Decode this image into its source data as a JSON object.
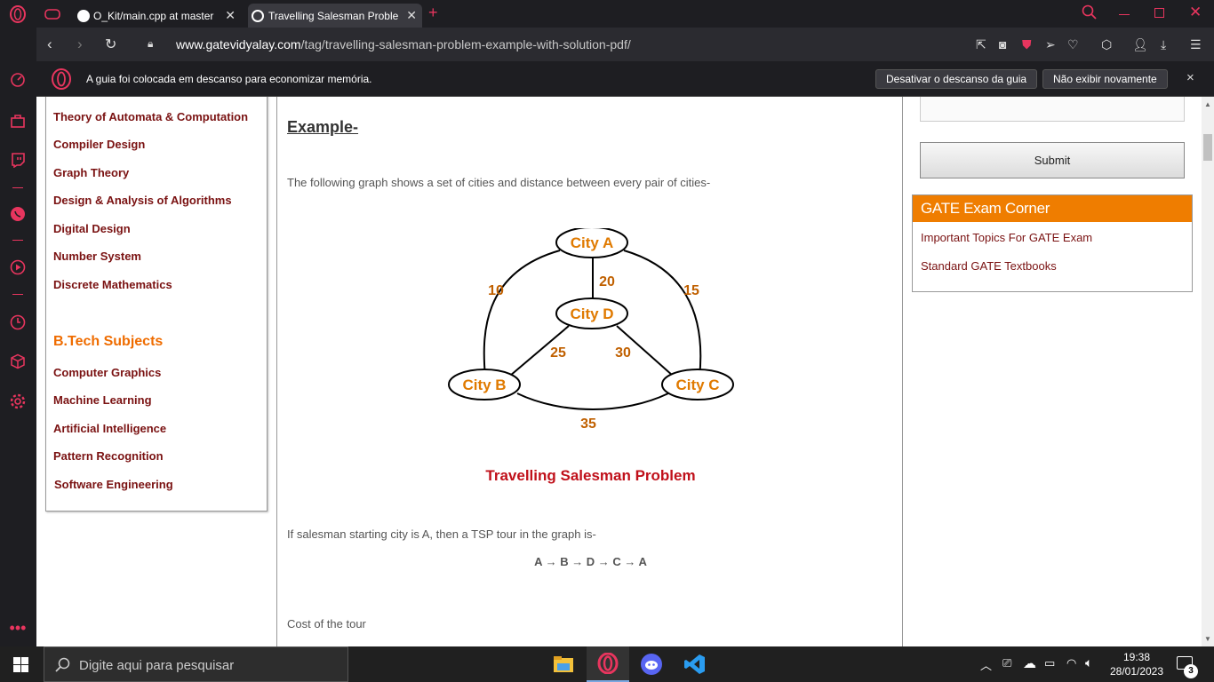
{
  "browser": {
    "tabs": [
      {
        "title": "O_Kit/main.cpp at master · "
      },
      {
        "title": "Travelling Salesman Problem"
      }
    ],
    "url_domain": "www.gatevidyalay.com",
    "url_path": "/tag/travelling-salesman-problem-example-with-solution-pdf/",
    "notification": "A guia foi colocada em descanso para economizar memória.",
    "notif_btn_wake": "Desativar o descanso da guia",
    "notif_btn_hide": "Não exibir novamente",
    "notif_close": "×"
  },
  "left_panel": {
    "links": [
      "Theory of Automata & Computation",
      "Compiler Design",
      "Graph Theory",
      "Design & Analysis of Algorithms",
      "Digital Design",
      "Number System",
      "Discrete Mathematics"
    ],
    "btech_title": "B.Tech Subjects",
    "btech_links": [
      "Computer Graphics",
      "Machine Learning",
      "Artificial Intelligence",
      "Pattern Recognition",
      "Software Engineering"
    ]
  },
  "main": {
    "heading": "Example-",
    "intro": "The following graph shows a set of cities and distance between every pair of cities-",
    "graph": {
      "nodes": [
        "City A",
        "City D",
        "City B",
        "City C"
      ],
      "edge_labels": {
        "ab": "10",
        "ad": "20",
        "ac": "15",
        "bd": "25",
        "cd": "30",
        "bc": "35"
      }
    },
    "caption": "Travelling Salesman Problem",
    "tour_intro": "If salesman starting city is A, then a TSP tour in the graph is-",
    "tour": "A → B → D → C → A",
    "cost": "Cost of the tour"
  },
  "right_panel": {
    "submit": "Submit",
    "gate_title": "GATE Exam Corner",
    "gate_links": [
      "Important Topics For GATE Exam",
      "Standard GATE Textbooks"
    ]
  },
  "taskbar": {
    "search_placeholder": "Digite aqui para pesquisar",
    "time": "19:38",
    "date": "28/01/2023",
    "notif_count": "3"
  },
  "colors": {
    "opera_red": "#e8355e",
    "link": "#7a1212",
    "orange": "#ef6c00",
    "caption_red": "#c0101a"
  }
}
